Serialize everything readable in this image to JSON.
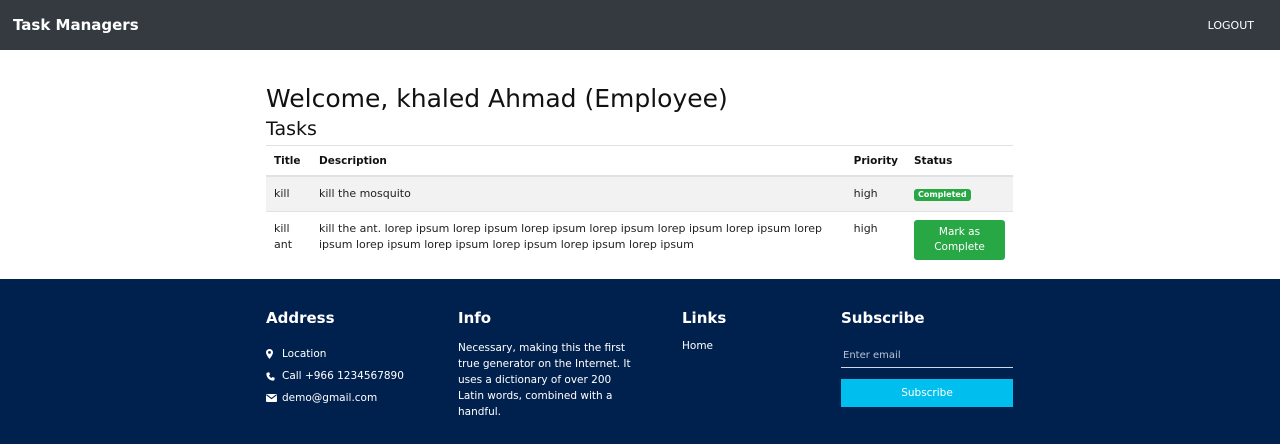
{
  "navbar": {
    "brand": "Task Managers",
    "logout": "LOGOUT"
  },
  "main": {
    "welcome": "Welcome, khaled Ahmad (Employee)",
    "tasks_title": "Tasks",
    "table": {
      "headers": [
        "Title",
        "Description",
        "Priority",
        "Status"
      ],
      "rows": [
        {
          "title": "kill",
          "description": "kill the mosquito",
          "priority": "high",
          "status": "Completed"
        },
        {
          "title": "kill ant",
          "description": "kill the ant. lorep ipsum lorep ipsum lorep ipsum lorep ipsum lorep ipsum lorep ipsum lorep ipsum lorep ipsum lorep ipsum lorep ipsum lorep ipsum lorep ipsum",
          "priority": "high",
          "status_button": "Mark as Complete"
        }
      ]
    }
  },
  "footer": {
    "address": {
      "heading": "Address",
      "location": "Location",
      "phone": "Call +966 1234567890",
      "email": "demo@gmail.com"
    },
    "info": {
      "heading": "Info",
      "text": "Necessary, making this the first true generator on the Internet. It uses a dictionary of over 200 Latin words, combined with a handful."
    },
    "links": {
      "heading": "Links",
      "items": [
        "Home"
      ]
    },
    "subscribe": {
      "heading": "Subscribe",
      "placeholder": "Enter email",
      "button": "Subscribe"
    }
  },
  "colors": {
    "navbar_bg": "#343a40",
    "footer_bg": "#00204d",
    "success": "#28a745",
    "subscribe_btn": "#00bfef"
  },
  "icons": [
    "map-marker-icon",
    "phone-icon",
    "envelope-icon"
  ]
}
